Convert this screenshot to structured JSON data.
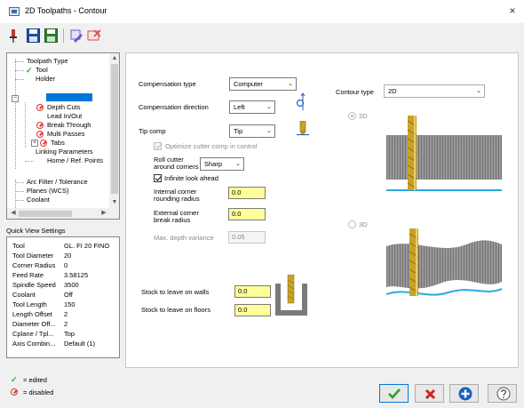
{
  "window": {
    "title": "2D Toolpaths - Contour",
    "close_glyph": "×"
  },
  "toolbar": {
    "icons": [
      "pin-icon",
      "save-icon",
      "save-as-icon",
      "reference-icon",
      "clear-icon"
    ]
  },
  "tree": {
    "items": [
      {
        "label": "Toolpath Type",
        "mark": "none"
      },
      {
        "label": "Tool",
        "mark": "edited"
      },
      {
        "label": "Holder",
        "mark": "none"
      },
      {
        "label": "",
        "mark": "selected"
      },
      {
        "label": "Depth Cuts",
        "mark": "disabled"
      },
      {
        "label": "Lead In/Out",
        "mark": "none"
      },
      {
        "label": "Break Through",
        "mark": "disabled"
      },
      {
        "label": "Multi Passes",
        "mark": "disabled"
      },
      {
        "label": "Tabs",
        "mark": "disabled"
      },
      {
        "label": "Linking Parameters",
        "mark": "none"
      },
      {
        "label": "Home / Ref. Points",
        "mark": "none"
      },
      {
        "label": "Arc Filter / Tolerance",
        "mark": "none"
      },
      {
        "label": "Planes (WCS)",
        "mark": "none"
      },
      {
        "label": "Coolant",
        "mark": "none"
      }
    ],
    "expander_plus": "+",
    "expander_minus": "−"
  },
  "quick_view": {
    "title": "Quick View Settings",
    "rows": [
      {
        "key": "Tool",
        "value": "GL. FI 20 FINO"
      },
      {
        "key": "Tool Diameter",
        "value": "20"
      },
      {
        "key": "Corner Radius",
        "value": "0"
      },
      {
        "key": "Feed Rate",
        "value": "3.58125"
      },
      {
        "key": "Spindle Speed",
        "value": "3500"
      },
      {
        "key": "Coolant",
        "value": "Off"
      },
      {
        "key": "Tool Length",
        "value": "150"
      },
      {
        "key": "Length Offset",
        "value": "2"
      },
      {
        "key": "Diameter Off...",
        "value": "2"
      },
      {
        "key": "Cplane / Tpl...",
        "value": "Top"
      },
      {
        "key": "Axis Combin...",
        "value": "Default (1)"
      }
    ]
  },
  "legend": {
    "edited": "= edited",
    "disabled": "= disabled"
  },
  "params": {
    "compensation_type": {
      "label": "Compensation type",
      "value": "Computer"
    },
    "compensation_direction": {
      "label": "Compensation direction",
      "value": "Left"
    },
    "tip_comp": {
      "label": "Tip comp",
      "value": "Tip"
    },
    "optimize": {
      "label": "Optimize cutter comp in control",
      "checked": true,
      "enabled": false
    },
    "roll_cutter": {
      "label_line1": "Roll cutter",
      "label_line2": "around corners",
      "value": "Sharp"
    },
    "infinite_look_ahead": {
      "label": "Infinite look ahead",
      "checked": true
    },
    "internal_corner": {
      "label_line1": "Internal corner",
      "label_line2": "rounding radius",
      "value": "0.0"
    },
    "external_corner": {
      "label_line1": "External corner",
      "label_line2": "break radius",
      "value": "0.0"
    },
    "max_depth_variance": {
      "label": "Max. depth variance",
      "value": "0.05"
    },
    "stock_walls": {
      "label": "Stock to leave on walls",
      "value": "0.0"
    },
    "stock_floors": {
      "label": "Stock to leave on floors",
      "value": "0.0"
    },
    "contour_type": {
      "label": "Contour type",
      "value": "2D"
    },
    "radio_2d": {
      "label": "2D",
      "selected": true
    },
    "radio_3d": {
      "label": "3D",
      "selected": false
    }
  },
  "colors": {
    "tool_gold": "#c9a227",
    "stock_grey": "#9a9a9a",
    "water_blue": "#2aa8e0",
    "accent_blue": "#0078d7",
    "field_yellow": "#ffff99"
  }
}
